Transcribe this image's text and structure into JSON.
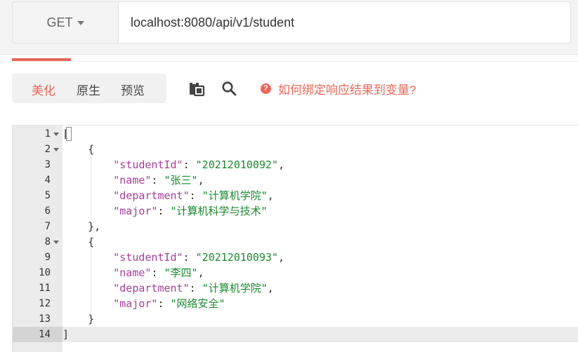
{
  "request": {
    "method": "GET",
    "url": "localhost:8080/api/v1/student"
  },
  "response": {
    "tabs": [
      {
        "label": "美化",
        "active": true
      },
      {
        "label": "原生",
        "active": false
      },
      {
        "label": "预览",
        "active": false
      }
    ],
    "tool_icons": [
      "copy-icon",
      "search-icon"
    ],
    "help_text": "如何绑定响应结果到变量?"
  },
  "editor": {
    "lines": [
      {
        "num": "1",
        "fold": true,
        "tokens": [
          {
            "t": "[",
            "c": "p"
          }
        ]
      },
      {
        "num": "2",
        "fold": true,
        "tokens": [
          {
            "t": "    {",
            "c": "p"
          }
        ]
      },
      {
        "num": "3",
        "fold": false,
        "tokens": [
          {
            "t": "        ",
            "c": "p"
          },
          {
            "t": "\"studentId\"",
            "c": "k"
          },
          {
            "t": ": ",
            "c": "p"
          },
          {
            "t": "\"20212010092\"",
            "c": "s"
          },
          {
            "t": ",",
            "c": "p"
          }
        ]
      },
      {
        "num": "4",
        "fold": false,
        "tokens": [
          {
            "t": "        ",
            "c": "p"
          },
          {
            "t": "\"name\"",
            "c": "k"
          },
          {
            "t": ": ",
            "c": "p"
          },
          {
            "t": "\"张三\"",
            "c": "s"
          },
          {
            "t": ",",
            "c": "p"
          }
        ]
      },
      {
        "num": "5",
        "fold": false,
        "tokens": [
          {
            "t": "        ",
            "c": "p"
          },
          {
            "t": "\"department\"",
            "c": "k"
          },
          {
            "t": ": ",
            "c": "p"
          },
          {
            "t": "\"计算机学院\"",
            "c": "s"
          },
          {
            "t": ",",
            "c": "p"
          }
        ]
      },
      {
        "num": "6",
        "fold": false,
        "tokens": [
          {
            "t": "        ",
            "c": "p"
          },
          {
            "t": "\"major\"",
            "c": "k"
          },
          {
            "t": ": ",
            "c": "p"
          },
          {
            "t": "\"计算机科学与技术\"",
            "c": "s"
          }
        ]
      },
      {
        "num": "7",
        "fold": false,
        "tokens": [
          {
            "t": "    },",
            "c": "p"
          }
        ]
      },
      {
        "num": "8",
        "fold": true,
        "tokens": [
          {
            "t": "    {",
            "c": "p"
          }
        ]
      },
      {
        "num": "9",
        "fold": false,
        "tokens": [
          {
            "t": "        ",
            "c": "p"
          },
          {
            "t": "\"studentId\"",
            "c": "k"
          },
          {
            "t": ": ",
            "c": "p"
          },
          {
            "t": "\"20212010093\"",
            "c": "s"
          },
          {
            "t": ",",
            "c": "p"
          }
        ]
      },
      {
        "num": "10",
        "fold": false,
        "tokens": [
          {
            "t": "        ",
            "c": "p"
          },
          {
            "t": "\"name\"",
            "c": "k"
          },
          {
            "t": ": ",
            "c": "p"
          },
          {
            "t": "\"李四\"",
            "c": "s"
          },
          {
            "t": ",",
            "c": "p"
          }
        ]
      },
      {
        "num": "11",
        "fold": false,
        "tokens": [
          {
            "t": "        ",
            "c": "p"
          },
          {
            "t": "\"department\"",
            "c": "k"
          },
          {
            "t": ": ",
            "c": "p"
          },
          {
            "t": "\"计算机学院\"",
            "c": "s"
          },
          {
            "t": ",",
            "c": "p"
          }
        ]
      },
      {
        "num": "12",
        "fold": false,
        "tokens": [
          {
            "t": "        ",
            "c": "p"
          },
          {
            "t": "\"major\"",
            "c": "k"
          },
          {
            "t": ": ",
            "c": "p"
          },
          {
            "t": "\"网络安全\"",
            "c": "s"
          }
        ]
      },
      {
        "num": "13",
        "fold": false,
        "tokens": [
          {
            "t": "    }",
            "c": "p"
          }
        ]
      },
      {
        "num": "14",
        "fold": false,
        "highlight": true,
        "tokens": [
          {
            "t": "]",
            "c": "p"
          }
        ]
      }
    ]
  },
  "colors": {
    "accent": "#e8685a",
    "json_key": "#a6409b",
    "json_string": "#1b8a2f"
  }
}
